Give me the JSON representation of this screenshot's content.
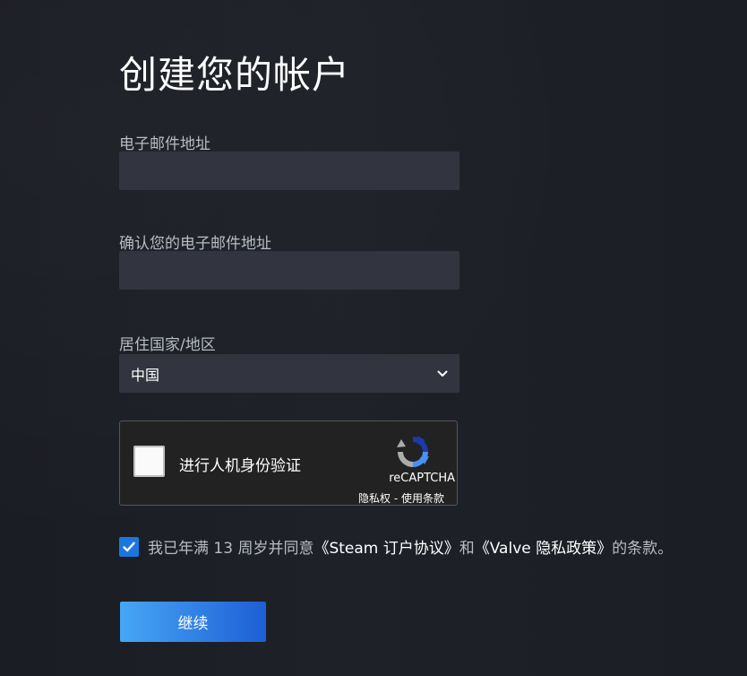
{
  "page": {
    "title": "创建您的帐户"
  },
  "form": {
    "email_label": "电子邮件地址",
    "email_value": "",
    "confirm_email_label": "确认您的电子邮件地址",
    "confirm_email_value": "",
    "country_label": "居住国家/地区",
    "country_selected": "中国"
  },
  "captcha": {
    "label": "进行人机身份验证",
    "brand": "reCAPTCHA",
    "privacy_link": "隐私权",
    "separator": " - ",
    "terms_link": "使用条款",
    "checked": false
  },
  "agreement": {
    "checked": true,
    "text_before": "我已年满 13 周岁并同意",
    "link1": "《Steam 订户协议》",
    "text_middle": "和",
    "link2": "《Valve 隐私政策》",
    "text_after": "的条款。"
  },
  "actions": {
    "continue_label": "继续"
  },
  "colors": {
    "background": "#1b1e24",
    "input_bg": "#32353f",
    "accent_blue": "#1a77e0",
    "button_gradient_start": "#47a6f5",
    "button_gradient_end": "#1d5fd6"
  },
  "icons": {
    "select_chevron": "chevron-down-icon",
    "checkbox_check": "check-icon",
    "recaptcha_logo": "recaptcha-logo-icon"
  }
}
